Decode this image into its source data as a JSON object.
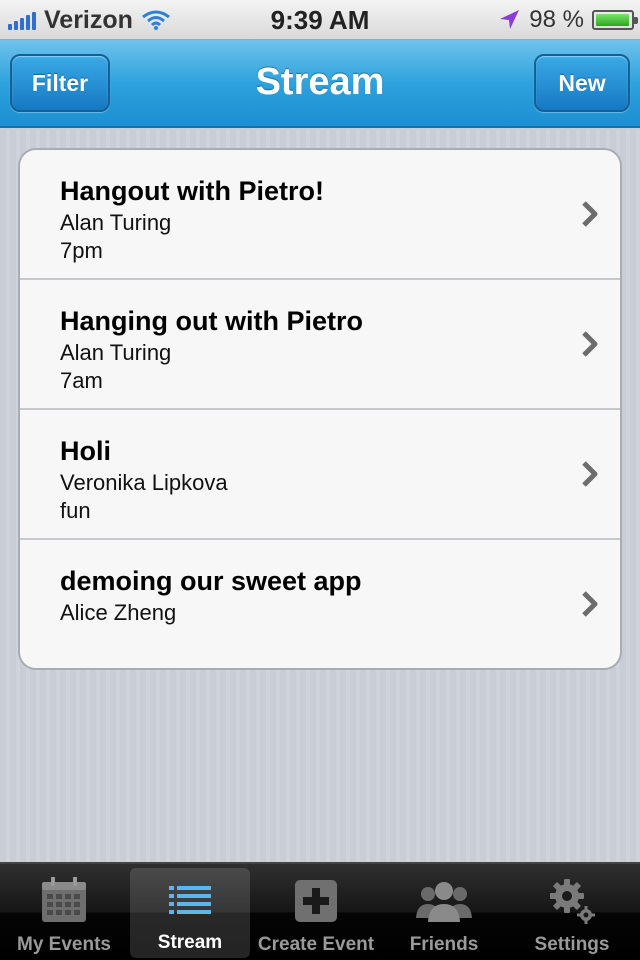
{
  "status_bar": {
    "carrier": "Verizon",
    "time": "9:39 AM",
    "battery_percent": "98 %",
    "battery_level": 0.98
  },
  "nav": {
    "title": "Stream",
    "left_button": "Filter",
    "right_button": "New"
  },
  "events": [
    {
      "title": "Hangout with Pietro!",
      "author": "Alan Turing",
      "detail": "7pm"
    },
    {
      "title": "Hanging out with Pietro",
      "author": "Alan Turing",
      "detail": "7am"
    },
    {
      "title": "Holi",
      "author": "Veronika Lipkova",
      "detail": "fun"
    },
    {
      "title": "demoing our sweet app",
      "author": "Alice Zheng",
      "detail": ""
    }
  ],
  "tabs": [
    {
      "label": "My Events",
      "icon": "calendar-icon",
      "active": false
    },
    {
      "label": "Stream",
      "icon": "list-icon",
      "active": true
    },
    {
      "label": "Create Event",
      "icon": "plus-icon",
      "active": false
    },
    {
      "label": "Friends",
      "icon": "people-icon",
      "active": false
    },
    {
      "label": "Settings",
      "icon": "gear-icon",
      "active": false
    }
  ],
  "colors": {
    "nav_blue": "#2ea2de",
    "active_tab_icon": "#5bb6ee",
    "battery_green": "#2ca61f",
    "location_arrow": "#8a3cd6"
  }
}
